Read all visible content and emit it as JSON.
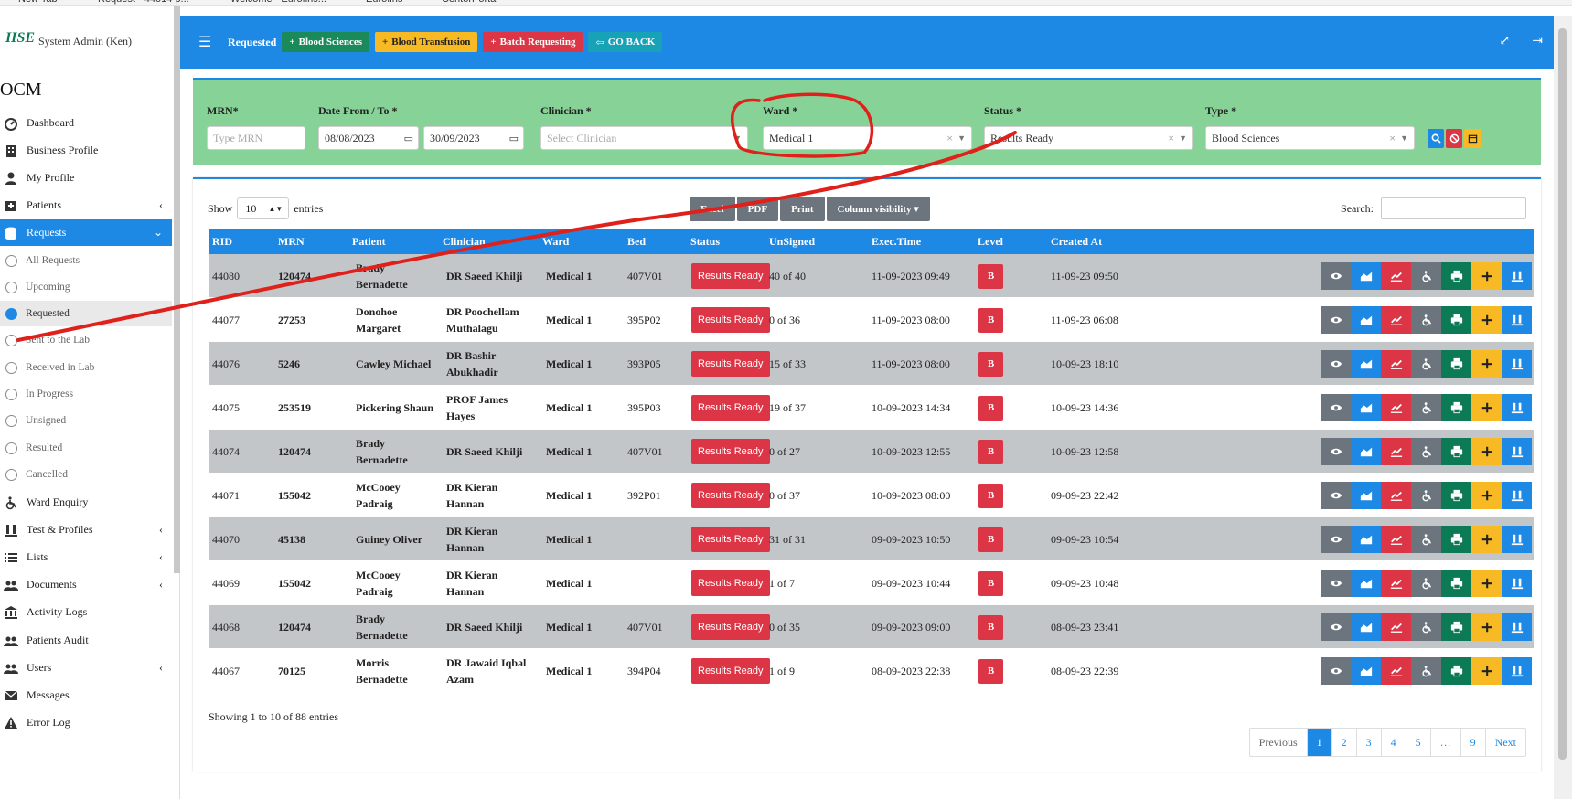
{
  "browser_tabs": [
    "New Tab",
    "Request - 44014 p...",
    "Welcome - Eurofins...",
    "Eurofins",
    "CentorPortal"
  ],
  "sidebar": {
    "user_name": "System Admin (Ken)",
    "logo_text": "HSE",
    "brand": "OCM",
    "items": [
      {
        "label": "Dashboard",
        "icon": "dashboard-icon"
      },
      {
        "label": "Business Profile",
        "icon": "building-icon"
      },
      {
        "label": "My Profile",
        "icon": "user-icon"
      },
      {
        "label": "Patients",
        "icon": "hospital-bed-icon",
        "chevron": "‹"
      },
      {
        "label": "Requests",
        "icon": "database-icon",
        "chevron": "⌄"
      },
      {
        "label": "Ward Enquiry",
        "icon": "wheelchair-icon"
      },
      {
        "label": "Test & Profiles",
        "icon": "vials-icon",
        "chevron": "‹"
      },
      {
        "label": "Lists",
        "icon": "list-icon",
        "chevron": "‹"
      },
      {
        "label": "Documents",
        "icon": "users-icon",
        "chevron": "‹"
      },
      {
        "label": "Activity Logs",
        "icon": "bank-icon"
      },
      {
        "label": "Patients Audit",
        "icon": "users-icon"
      },
      {
        "label": "Users",
        "icon": "users-icon",
        "chevron": "‹"
      },
      {
        "label": "Messages",
        "icon": "envelope-icon"
      },
      {
        "label": "Error Log",
        "icon": "warning-icon"
      }
    ],
    "request_sub": [
      "All Requests",
      "Upcoming",
      "Requested",
      "Sent to the Lab",
      "Received in Lab",
      "In Progress",
      "Unsigned",
      "Resulted",
      "Cancelled"
    ]
  },
  "topbar": {
    "title": "Requested",
    "buttons": [
      {
        "label": "Blood Sciences",
        "prefix": "+",
        "color": "#1a8a5a"
      },
      {
        "label": "Blood Transfusion",
        "prefix": "+",
        "color": "#f7b924",
        "text_color": "#222"
      },
      {
        "label": "Batch Requesting",
        "prefix": "+",
        "color": "#dc3545"
      },
      {
        "label": "GO BACK",
        "prefix": "⇦",
        "color": "#17a2b8"
      }
    ]
  },
  "filters": {
    "mrn_label": "MRN*",
    "mrn_placeholder": "Type MRN",
    "date_label": "Date From / To *",
    "date_from": "08/08/2023",
    "date_to": "30/09/2023",
    "clinician_label": "Clinician *",
    "clinician_placeholder": "Select Clinician",
    "ward_label": "Ward *",
    "ward_value": "Medical 1",
    "status_label": "Status *",
    "status_value": "Results Ready",
    "type_label": "Type *",
    "type_value": "Blood Sciences"
  },
  "table_controls": {
    "show": "Show",
    "entries_value": "10",
    "entries": "entries",
    "export_buttons": [
      "Excel",
      "PDF",
      "Print",
      "Column visibility ▾"
    ],
    "search_label": "Search:"
  },
  "columns": [
    "RID",
    "MRN",
    "Patient",
    "Clinician",
    "Ward",
    "Bed",
    "Status",
    "UnSigned",
    "Exec.Time",
    "Level",
    "Created At"
  ],
  "rows": [
    {
      "rid": "44080",
      "mrn": "120474",
      "patient": "Brady Bernadette",
      "clinician": "DR Saeed Khilji",
      "ward": "Medical 1",
      "bed": "407V01",
      "status": "Results Ready",
      "unsigned": "40 of 40",
      "exec": "11-09-2023 09:49",
      "level": "B",
      "created": "11-09-23 09:50"
    },
    {
      "rid": "44077",
      "mrn": "27253",
      "patient": "Donohoe Margaret",
      "clinician": "DR Poochellam Muthalagu",
      "ward": "Medical 1",
      "bed": "395P02",
      "status": "Results Ready",
      "unsigned": "0 of 36",
      "exec": "11-09-2023 08:00",
      "level": "B",
      "created": "11-09-23 06:08"
    },
    {
      "rid": "44076",
      "mrn": "5246",
      "patient": "Cawley Michael",
      "clinician": "DR Bashir Abukhadir",
      "ward": "Medical 1",
      "bed": "393P05",
      "status": "Results Ready",
      "unsigned": "15 of 33",
      "exec": "11-09-2023 08:00",
      "level": "B",
      "created": "10-09-23 18:10"
    },
    {
      "rid": "44075",
      "mrn": "253519",
      "patient": "Pickering Shaun",
      "clinician": "PROF James Hayes",
      "ward": "Medical 1",
      "bed": "395P03",
      "status": "Results Ready",
      "unsigned": "19 of 37",
      "exec": "10-09-2023 14:34",
      "level": "B",
      "created": "10-09-23 14:36"
    },
    {
      "rid": "44074",
      "mrn": "120474",
      "patient": "Brady Bernadette",
      "clinician": "DR Saeed Khilji",
      "ward": "Medical 1",
      "bed": "407V01",
      "status": "Results Ready",
      "unsigned": "0 of 27",
      "exec": "10-09-2023 12:55",
      "level": "B",
      "created": "10-09-23 12:58"
    },
    {
      "rid": "44071",
      "mrn": "155042",
      "patient": "McCooey Padraig",
      "clinician": "DR Kieran Hannan",
      "ward": "Medical 1",
      "bed": "392P01",
      "status": "Results Ready",
      "unsigned": "0 of 37",
      "exec": "10-09-2023 08:00",
      "level": "B",
      "created": "09-09-23 22:42"
    },
    {
      "rid": "44070",
      "mrn": "45138",
      "patient": "Guiney Oliver",
      "clinician": "DR Kieran Hannan",
      "ward": "Medical 1",
      "bed": "",
      "status": "Results Ready",
      "unsigned": "31 of 31",
      "exec": "09-09-2023 10:50",
      "level": "B",
      "created": "09-09-23 10:54"
    },
    {
      "rid": "44069",
      "mrn": "155042",
      "patient": "McCooey Padraig",
      "clinician": "DR Kieran Hannan",
      "ward": "Medical 1",
      "bed": "",
      "status": "Results Ready",
      "unsigned": "1 of 7",
      "exec": "09-09-2023 10:44",
      "level": "B",
      "created": "09-09-23 10:48"
    },
    {
      "rid": "44068",
      "mrn": "120474",
      "patient": "Brady Bernadette",
      "clinician": "DR Saeed Khilji",
      "ward": "Medical 1",
      "bed": "407V01",
      "status": "Results Ready",
      "unsigned": "0 of 35",
      "exec": "09-09-2023 09:00",
      "level": "B",
      "created": "08-09-23 23:41"
    },
    {
      "rid": "44067",
      "mrn": "70125",
      "patient": "Morris Bernadette",
      "clinician": "DR Jawaid Iqbal Azam",
      "ward": "Medical 1",
      "bed": "394P04",
      "status": "Results Ready",
      "unsigned": "1 of 9",
      "exec": "08-09-2023 22:38",
      "level": "B",
      "created": "08-09-23 22:39"
    }
  ],
  "row_actions": [
    {
      "icon": "eye-icon",
      "color": "#6c757d"
    },
    {
      "icon": "area-chart-icon",
      "color": "#1e88e5"
    },
    {
      "icon": "line-chart-icon",
      "color": "#dc3545"
    },
    {
      "icon": "wheelchair-icon",
      "color": "#6c757d"
    },
    {
      "icon": "print-icon",
      "color": "#0b7a55"
    },
    {
      "icon": "plus-icon",
      "color": "#f7b924"
    },
    {
      "icon": "vials-icon",
      "color": "#1e88e5"
    }
  ],
  "footer": {
    "info": "Showing 1 to 10 of 88 entries",
    "pages": [
      "Previous",
      "1",
      "2",
      "3",
      "4",
      "5",
      "…",
      "9",
      "Next"
    ]
  }
}
